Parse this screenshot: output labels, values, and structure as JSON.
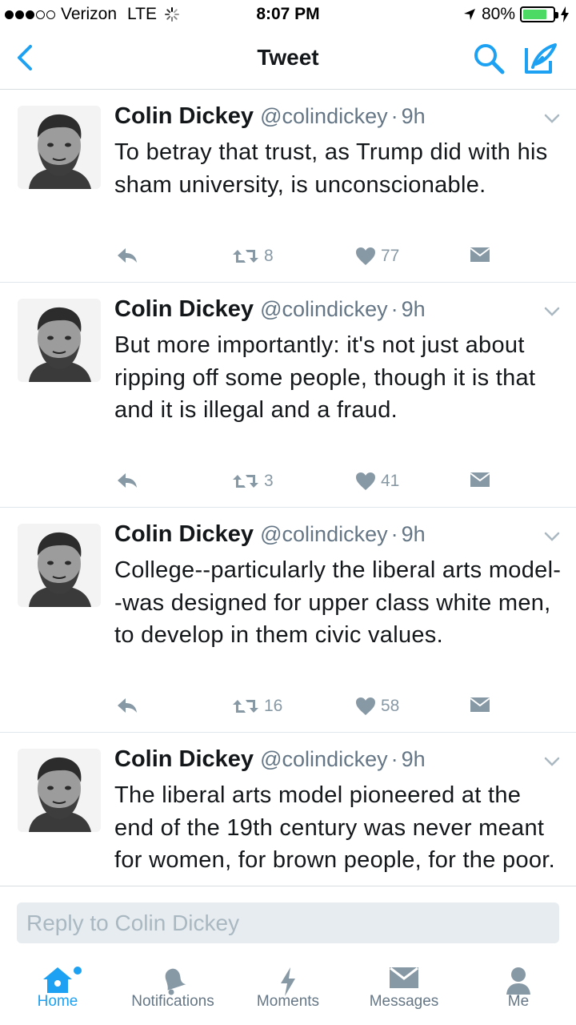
{
  "status_bar": {
    "carrier": "Verizon",
    "network": "LTE",
    "time": "8:07 PM",
    "battery_percent": "80%",
    "battery_level": 0.8,
    "signal_bars_filled": 3,
    "signal_bars_total": 5
  },
  "nav": {
    "title": "Tweet",
    "back_icon": "chevron-left-icon",
    "search_icon": "search-icon",
    "compose_icon": "compose-quill-icon"
  },
  "colors": {
    "accent": "#1da1f2",
    "text": "#14171a",
    "secondary_text": "#657786",
    "action_gray": "#8899a6",
    "divider": "#e1e8ed"
  },
  "tweets": [
    {
      "name": "Colin Dickey",
      "handle": "@colindickey",
      "separator": "·",
      "time": "9h",
      "text": "To betray that trust, as Trump did with his sham university, is unconscionable.",
      "retweets": "8",
      "likes": "77"
    },
    {
      "name": "Colin Dickey",
      "handle": "@colindickey",
      "separator": "·",
      "time": "9h",
      "text": "But more importantly: it's not just about ripping off some people, though it is that and it is illegal and a fraud.",
      "retweets": "3",
      "likes": "41"
    },
    {
      "name": "Colin Dickey",
      "handle": "@colindickey",
      "separator": "·",
      "time": "9h",
      "text": "College--particularly the liberal arts model--was designed for upper class white men, to develop in them civic values.",
      "retweets": "16",
      "likes": "58"
    },
    {
      "name": "Colin Dickey",
      "handle": "@colindickey",
      "separator": "·",
      "time": "9h",
      "text": "The liberal arts model pioneered at the end of the 19th century was never meant for women, for brown people, for the poor.",
      "retweets": "",
      "likes": ""
    }
  ],
  "reply": {
    "placeholder": "Reply to Colin Dickey",
    "value": ""
  },
  "tabs": [
    {
      "label": "Home",
      "icon": "home-icon",
      "active": true
    },
    {
      "label": "Notifications",
      "icon": "bell-icon",
      "active": false
    },
    {
      "label": "Moments",
      "icon": "lightning-icon",
      "active": false
    },
    {
      "label": "Messages",
      "icon": "envelope-icon",
      "active": false
    },
    {
      "label": "Me",
      "icon": "person-icon",
      "active": false
    }
  ]
}
